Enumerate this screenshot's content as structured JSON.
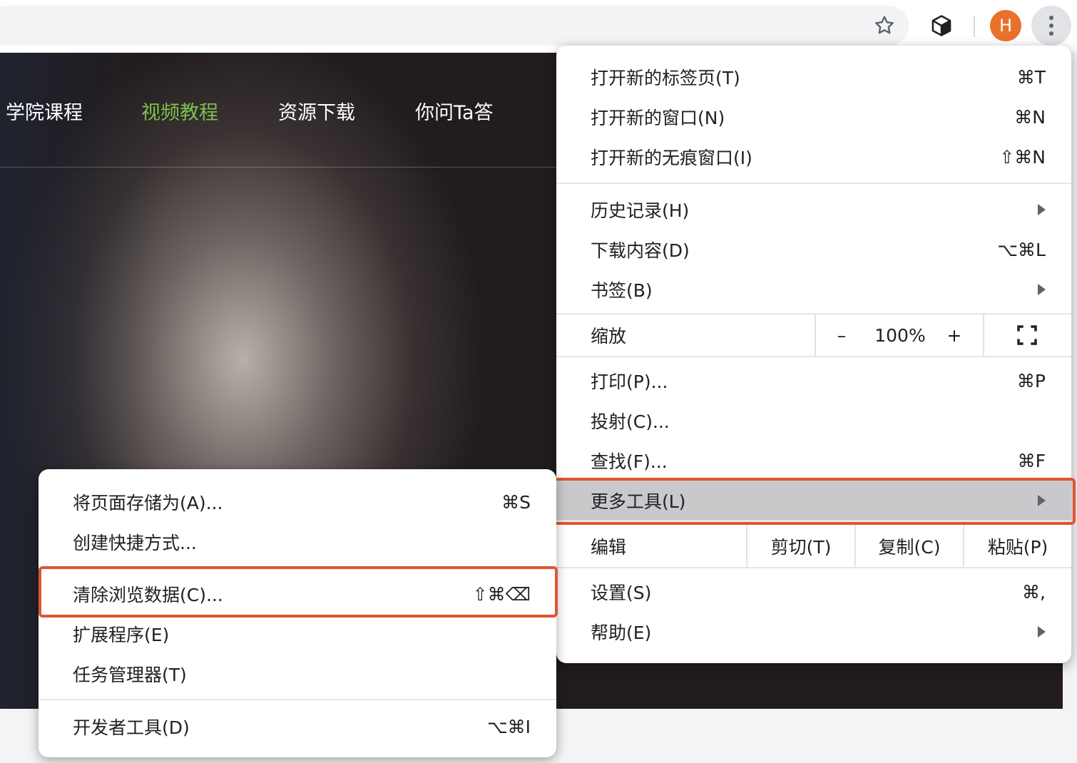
{
  "toolbar": {
    "star_icon": "star-outline-icon",
    "extension_icon": "cube-icon",
    "avatar_letter": "H",
    "avatar_color": "#e9712b",
    "menu_icon": "kebab-icon"
  },
  "site_nav": {
    "items": [
      {
        "label": "学院课程"
      },
      {
        "label": "视频教程",
        "active": true
      },
      {
        "label": "资源下载"
      },
      {
        "label": "你问Ta答"
      }
    ],
    "active_color": "#7cc14a"
  },
  "main_menu": {
    "new_tab": {
      "label": "打开新的标签页(T)",
      "shortcut": "⌘T"
    },
    "new_window": {
      "label": "打开新的窗口(N)",
      "shortcut": "⌘N"
    },
    "new_incognito": {
      "label": "打开新的无痕窗口(I)",
      "shortcut": "⇧⌘N"
    },
    "history": {
      "label": "历史记录(H)"
    },
    "downloads": {
      "label": "下载内容(D)",
      "shortcut": "⌥⌘L"
    },
    "bookmarks": {
      "label": "书签(B)"
    },
    "zoom": {
      "label": "缩放",
      "minus": "–",
      "value": "100%",
      "plus": "+"
    },
    "print": {
      "label": "打印(P)...",
      "shortcut": "⌘P"
    },
    "cast": {
      "label": "投射(C)..."
    },
    "find": {
      "label": "查找(F)...",
      "shortcut": "⌘F"
    },
    "more_tools": {
      "label": "更多工具(L)"
    },
    "edit": {
      "label": "编辑",
      "cut": "剪切(T)",
      "copy": "复制(C)",
      "paste": "粘贴(P)"
    },
    "settings": {
      "label": "设置(S)",
      "shortcut": "⌘,"
    },
    "help": {
      "label": "帮助(E)"
    }
  },
  "sub_menu": {
    "save_page": {
      "label": "将页面存储为(A)...",
      "shortcut": "⌘S"
    },
    "create_shortcut": {
      "label": "创建快捷方式..."
    },
    "clear_data": {
      "label": "清除浏览数据(C)...",
      "shortcut": "⇧⌘⌫"
    },
    "extensions": {
      "label": "扩展程序(E)"
    },
    "task_manager": {
      "label": "任务管理器(T)"
    },
    "dev_tools": {
      "label": "开发者工具(D)",
      "shortcut": "⌥⌘I"
    }
  },
  "highlight_color": "#e0552f"
}
